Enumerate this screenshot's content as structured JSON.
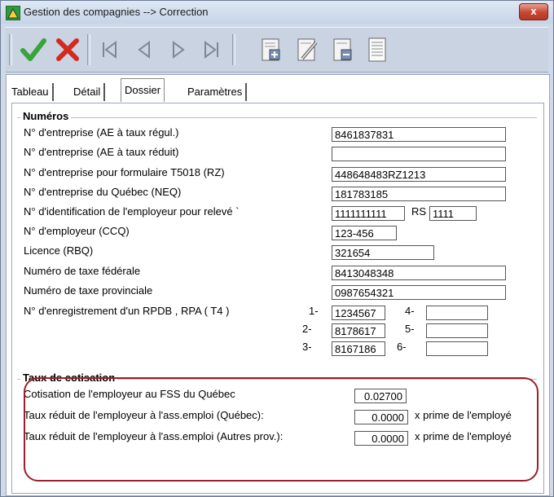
{
  "window": {
    "title": "Gestion des compagnies --> Correction",
    "close_label": "x"
  },
  "toolbar": {
    "buttons": [
      "accept-icon",
      "cancel-icon",
      "first-record-icon",
      "previous-record-icon",
      "next-record-icon",
      "last-record-icon",
      "add-record-icon",
      "edit-record-icon",
      "delete-record-icon",
      "report-icon"
    ]
  },
  "tabs": [
    "Tableau",
    "Détail",
    "Dossier",
    "Paramètres"
  ],
  "numeros": {
    "legend": "Numéros",
    "rows": [
      {
        "label": "N° d'entreprise (AE à taux régul.)",
        "value": "8461837831"
      },
      {
        "label": "N° d'entreprise (AE à taux réduit)",
        "value": ""
      },
      {
        "label": "N° d'entreprise pour formulaire T5018 (RZ)",
        "value": "448648483RZ1213"
      },
      {
        "label": "N° d'entreprise du Québec (NEQ)",
        "value": "181783185"
      },
      {
        "label": "N° d'identification de l'employeur pour relevé `",
        "value": "1111111111",
        "rs_label": "RS",
        "rs_value": "1111"
      },
      {
        "label": "N° d'employeur (CCQ)",
        "value": "123-456"
      },
      {
        "label": "Licence (RBQ)",
        "value": "321654"
      },
      {
        "label": "Numéro de taxe fédérale",
        "value": "8413048348"
      },
      {
        "label": "Numéro de taxe provinciale",
        "value": "0987654321"
      }
    ],
    "rpdb": {
      "label": "N° d'enregistrement d'un RPDB , RPA ( T4 )",
      "items": [
        {
          "num": "1-",
          "value": "1234567"
        },
        {
          "num": "2-",
          "value": "8178617"
        },
        {
          "num": "3-",
          "value": "8167186"
        },
        {
          "num": "4-",
          "value": ""
        },
        {
          "num": "5-",
          "value": ""
        },
        {
          "num": "6-",
          "value": ""
        }
      ]
    }
  },
  "taux": {
    "legend": "Taux de cotisation",
    "rows": [
      {
        "label": "Cotisation de l'employeur au FSS du Québec",
        "value": "0.02700",
        "suffix": ""
      },
      {
        "label": "Taux réduit de l'employeur à l'ass.emploi  (Québec):",
        "value": "0.0000",
        "suffix": "x prime de l'employé"
      },
      {
        "label": "Taux réduit de l'employeur à l'ass.emploi  (Autres prov.):",
        "value": "0.0000",
        "suffix": "x prime de l'employé"
      }
    ]
  },
  "colors": {
    "highlight": "#9a2030",
    "accept": "#3aa33a",
    "cancel": "#d42a1e"
  }
}
